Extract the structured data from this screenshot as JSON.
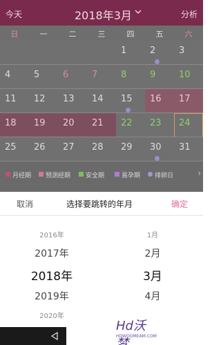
{
  "header": {
    "today_label": "今天",
    "month_label": "2018年3月",
    "analysis_label": "分析",
    "chevron_icon": "chevron-down-icon"
  },
  "weekdays": [
    "日",
    "一",
    "二",
    "三",
    "四",
    "五",
    "六"
  ],
  "calendar": {
    "rows": [
      [
        {
          "d": ""
        },
        {
          "d": ""
        },
        {
          "d": ""
        },
        {
          "d": ""
        },
        {
          "d": "1",
          "c": "#dddddd"
        },
        {
          "d": "2",
          "c": "#dddddd",
          "dot": true
        },
        {
          "d": "3",
          "c": "#dddddd"
        }
      ],
      [
        {
          "d": "4",
          "c": "#dddddd"
        },
        {
          "d": "5",
          "c": "#dddddd"
        },
        {
          "d": "6",
          "c": "#d58aa8"
        },
        {
          "d": "7",
          "c": "#d58aa8"
        },
        {
          "d": "8",
          "c": "#8fcf6a"
        },
        {
          "d": "9",
          "c": "#8fcf6a"
        },
        {
          "d": "10",
          "c": "#8fcf6a"
        }
      ],
      [
        {
          "d": "11",
          "c": "#dddddd"
        },
        {
          "d": "12",
          "c": "#dddddd"
        },
        {
          "d": "13",
          "c": "#dddddd"
        },
        {
          "d": "14",
          "c": "#dddddd"
        },
        {
          "d": "15",
          "c": "#dddddd",
          "dot": true
        },
        {
          "d": "16",
          "c": "#f0c8d6",
          "bg": "predict"
        },
        {
          "d": "17",
          "c": "#f0c8d6",
          "bg": "predict"
        }
      ],
      [
        {
          "d": "18",
          "c": "#f0c8d6",
          "bg": "period"
        },
        {
          "d": "19",
          "c": "#f0c8d6",
          "bg": "period"
        },
        {
          "d": "20",
          "c": "#f0c8d6",
          "bg": "period"
        },
        {
          "d": "21",
          "c": "#f0c8d6",
          "bg": "period"
        },
        {
          "d": "22",
          "c": "#8fcf6a"
        },
        {
          "d": "23",
          "c": "#8fcf6a"
        },
        {
          "d": "24",
          "c": "#8fcf6a",
          "highlight": true
        }
      ],
      [
        {
          "d": "25",
          "c": "#dddddd"
        },
        {
          "d": "26",
          "c": "#dddddd"
        },
        {
          "d": "27",
          "c": "#dddddd"
        },
        {
          "d": "28",
          "c": "#dddddd"
        },
        {
          "d": "29",
          "c": "#dddddd"
        },
        {
          "d": "30",
          "c": "#dddddd",
          "dot": true
        },
        {
          "d": "31",
          "c": "#dddddd"
        }
      ]
    ]
  },
  "legend": [
    {
      "label": "月经期",
      "color": "#c0506e",
      "shape": "square"
    },
    {
      "label": "预测经期",
      "color": "#d07a96",
      "shape": "square"
    },
    {
      "label": "安全期",
      "color": "#7cbf58",
      "shape": "square"
    },
    {
      "label": "易孕期",
      "color": "#b37ad6",
      "shape": "square"
    },
    {
      "label": "排卵日",
      "color": "#a09ac8",
      "shape": "circle"
    }
  ],
  "picker": {
    "cancel_label": "取消",
    "title": "选择要跳转的年月",
    "confirm_label": "确定",
    "years": [
      "2016年",
      "2017年",
      "2018年",
      "2019年",
      "2020年"
    ],
    "months": [
      "1月",
      "2月",
      "3月",
      "4月"
    ]
  },
  "watermark": {
    "logo_text": "Hd沃梦",
    "sub_text": "HDWOOMEAM.COM"
  }
}
